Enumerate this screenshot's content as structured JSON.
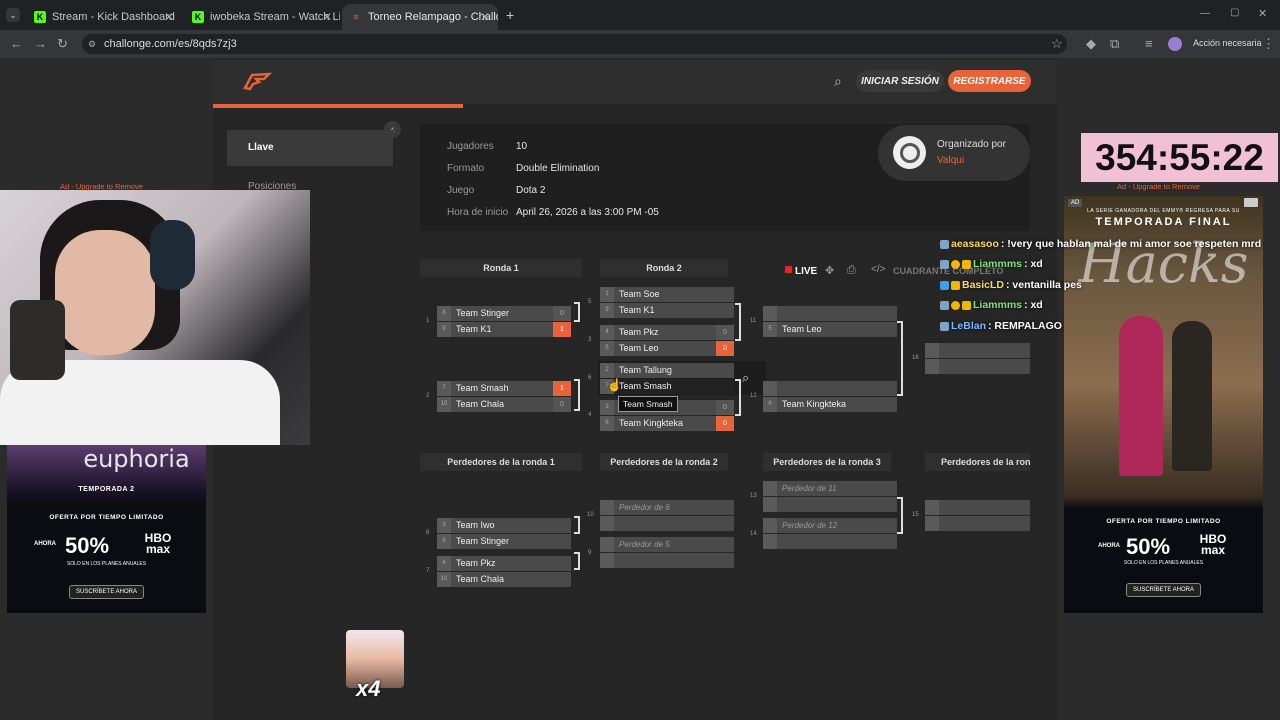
{
  "browser": {
    "tabs": [
      {
        "label": "Stream - Kick Dashboard",
        "icon": "kick-icon"
      },
      {
        "label": "iwobeka Stream - Watch Live o",
        "icon": "kick-icon"
      },
      {
        "label": "Torneo Relampago - Challonge",
        "icon": "challonge-icon"
      }
    ],
    "url": "challonge.com/es/8qds7zj3",
    "profile_action": "Acción necesaria"
  },
  "site": {
    "login": "INICIAR SESIÓN",
    "register": "REGISTRARSE",
    "sidebar": [
      "Llave",
      "Posiciones"
    ],
    "info": [
      {
        "label": "Jugadores",
        "value": "10"
      },
      {
        "label": "Formato",
        "value": "Double Elimination"
      },
      {
        "label": "Juego",
        "value": "Dota 2"
      },
      {
        "label": "Hora de inicio",
        "value": "April 26, 2026 a las 3:00 PM -05"
      }
    ],
    "organizer_label": "Organizado por",
    "organizer_name": "Valqui",
    "live": "LIVE",
    "fullscreen": "CUADRANTE COMPLETO",
    "winners_rounds": [
      "Ronda 1",
      "Ronda 2"
    ],
    "losers_rounds": [
      "Perdedores de la ronda 1",
      "Perdedores de la ronda 2",
      "Perdedores de la ronda 3",
      "Perdedores de la ronda"
    ],
    "tooltip": "Team Smash",
    "matches": {
      "w1": {
        "num": "1",
        "a": {
          "seed": "8",
          "name": "Team Stinger",
          "score": "0"
        },
        "b": {
          "seed": "9",
          "name": "Team K1",
          "score": "1"
        }
      },
      "w2": {
        "num": "2",
        "a": {
          "seed": "7",
          "name": "Team Smash",
          "score": "1"
        },
        "b": {
          "seed": "10",
          "name": "Team Chala",
          "score": "0"
        }
      },
      "w5": {
        "num": "5",
        "a": {
          "seed": "1",
          "name": "Team Soe",
          "score": ""
        },
        "b": {
          "seed": "9",
          "name": "Team K1",
          "score": ""
        }
      },
      "w3": {
        "num": "3",
        "a": {
          "seed": "4",
          "name": "Team Pkz",
          "score": "0"
        },
        "b": {
          "seed": "5",
          "name": "Team Leo",
          "score": "0"
        }
      },
      "w6": {
        "num": "6",
        "a": {
          "seed": "2",
          "name": "Team Tallung",
          "score": ""
        },
        "b": {
          "seed": "7",
          "name": "Team Smash",
          "score": ""
        }
      },
      "w4": {
        "num": "4",
        "a": {
          "seed": "3",
          "name": "",
          "score": "0"
        },
        "b": {
          "seed": "6",
          "name": "Team Kingkteka",
          "score": "0"
        }
      },
      "w11": {
        "num": "11",
        "a": {
          "seed": "",
          "name": "",
          "score": ""
        },
        "b": {
          "seed": "5",
          "name": "Team Leo",
          "score": ""
        }
      },
      "w12": {
        "num": "12",
        "a": {
          "seed": "",
          "name": "",
          "score": ""
        },
        "b": {
          "seed": "6",
          "name": "Team Kingkteka",
          "score": ""
        }
      },
      "w16": {
        "num": "16"
      },
      "l8": {
        "num": "8",
        "a": {
          "seed": "3",
          "name": "Team Iwo"
        },
        "b": {
          "seed": "8",
          "name": "Team Stinger"
        }
      },
      "l7": {
        "num": "7",
        "a": {
          "seed": "4",
          "name": "Team Pkz"
        },
        "b": {
          "seed": "10",
          "name": "Team Chala"
        }
      },
      "l10": {
        "num": "10",
        "a": "Perdedor de 6"
      },
      "l9": {
        "num": "9",
        "a": "Perdedor de 5"
      },
      "l13": {
        "num": "13",
        "a": "Perdedor de 11"
      },
      "l14": {
        "num": "14",
        "a": "Perdedor de 12"
      },
      "l15": {
        "num": "15"
      }
    }
  },
  "overlay": {
    "ad_notice": "Ad - Upgrade to Remove",
    "timer": "354:55:22",
    "chat": [
      {
        "user": "aeasasoo",
        "msg": ": !very que hablan mal de mi amor soe respeten mrd",
        "color": "#ffd75e"
      },
      {
        "user": "Liammms",
        "msg": ": xd",
        "color": "#7ee37e"
      },
      {
        "user": "BasicLD",
        "msg": ": ventanilla pes",
        "color": "#ffd75e"
      },
      {
        "user": "Liammms",
        "msg": ": xd",
        "color": "#7ee37e"
      },
      {
        "user": "LeBlan",
        "msg": ": REMPALAGO",
        "color": "#7fb8ff"
      }
    ],
    "left_ad": {
      "title": "euphoria",
      "season": "TEMPORADA 2",
      "offer": "OFERTA POR TIEMPO LIMITADO",
      "ahora": "AHORA",
      "pct": "50%",
      "brand": "HBO max",
      "sub": "SOLO EN LOS PLANES ANUALES",
      "cta": "SUSCRÍBETE AHORA"
    },
    "right_ad": {
      "top": "LA SERIE GANADORA DEL EMMY® REGRESA PARA SU",
      "season": "TEMPORADA FINAL",
      "title": "Hacks",
      "offer": "OFERTA POR TIEMPO LIMITADO",
      "ahora": "AHORA",
      "pct": "50%",
      "brand": "HBO max",
      "sub": "SOLO EN LOS PLANES ANUALES",
      "cta": "SUSCRÍBETE AHORA",
      "adtag": "AD"
    },
    "multiplier": "x4"
  },
  "colors": {
    "accent": "#e8633a",
    "timer_bg": "#f2c0d4"
  }
}
